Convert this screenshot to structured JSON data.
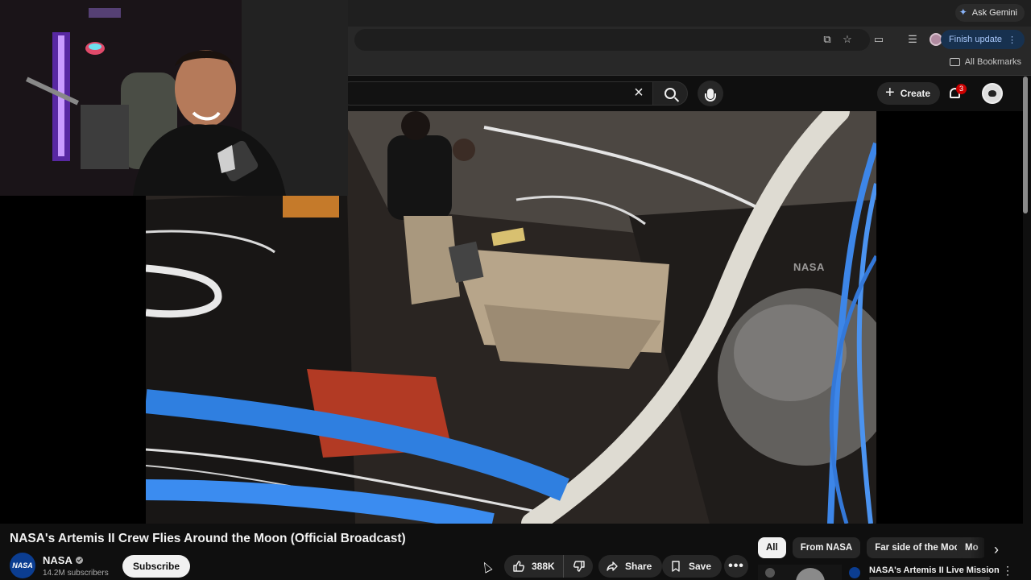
{
  "browser": {
    "ask_gemini_label": "Ask Gemini",
    "finish_update_label": "Finish update",
    "all_bookmarks_label": "All Bookmarks"
  },
  "header": {
    "create_label": "Create",
    "notification_count": "3",
    "search_clear_icon": "close-icon"
  },
  "video": {
    "watermark": "NASA",
    "title": "NASA's Artemis II Crew Flies Around the Moon (Official Broadcast)"
  },
  "channel": {
    "name": "NASA",
    "subscribers": "14.2M subscribers",
    "avatar_text": "NASA",
    "subscribe_label": "Subscribe"
  },
  "actions": {
    "like_count": "388K",
    "share_label": "Share",
    "save_label": "Save",
    "more_label": "•••"
  },
  "chips": [
    {
      "label": "All",
      "active": true
    },
    {
      "label": "From NASA",
      "active": false
    },
    {
      "label": "Far side of the Moon",
      "active": false
    },
    {
      "label": "Mo",
      "active": false
    }
  ],
  "recommendation": {
    "title": "NASA's Artemis II Live Mission"
  },
  "colors": {
    "page_bg": "#0f0f0f",
    "chrome_bg": "#1f1f1f",
    "accent_blue": "#a8c7fa",
    "badge_red": "#cc0000",
    "nasa_blue": "#0b3d91"
  }
}
